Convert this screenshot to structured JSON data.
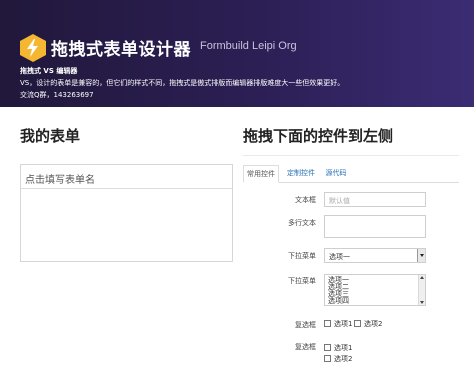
{
  "banner": {
    "title": "拖拽式表单设计器",
    "subtitle": "Formbuild Leipi Org",
    "line1": "拖拽式 VS 编辑器",
    "line2": "VS，设计的表单是兼容的，但它们的样式不同，拖拽式是傲式排版而编辑器排版难度大一些但效果更好。",
    "line3": "交流Q群，143263697"
  },
  "left": {
    "heading": "我的表单",
    "form_name_placeholder": "点击填写表单名"
  },
  "right": {
    "heading": "拖拽下面的控件到左侧",
    "tabs": [
      "常用控件",
      "定制控件",
      "源代码"
    ]
  },
  "controls": {
    "text_label": "文本框",
    "text_placeholder": "默认值",
    "textarea_label": "多行文本",
    "select_label": "下拉菜单",
    "select_value": "选项一",
    "list_label": "下拉菜单",
    "list_options": [
      "选项一",
      "选项二",
      "选项三",
      "选项四"
    ],
    "checkbox_label": "复选框",
    "checkbox_options": [
      "选项1",
      "选项2"
    ],
    "checkbox2_label": "复选框",
    "checkbox2_options": [
      "选项1",
      "选项2"
    ]
  },
  "colors": {
    "banner_start": "#21183b",
    "banner_end": "#3b2c73",
    "logo": "#f5b731",
    "link": "#2a6fb6"
  },
  "icons": {
    "logo": "lightning-hexagon-icon"
  }
}
